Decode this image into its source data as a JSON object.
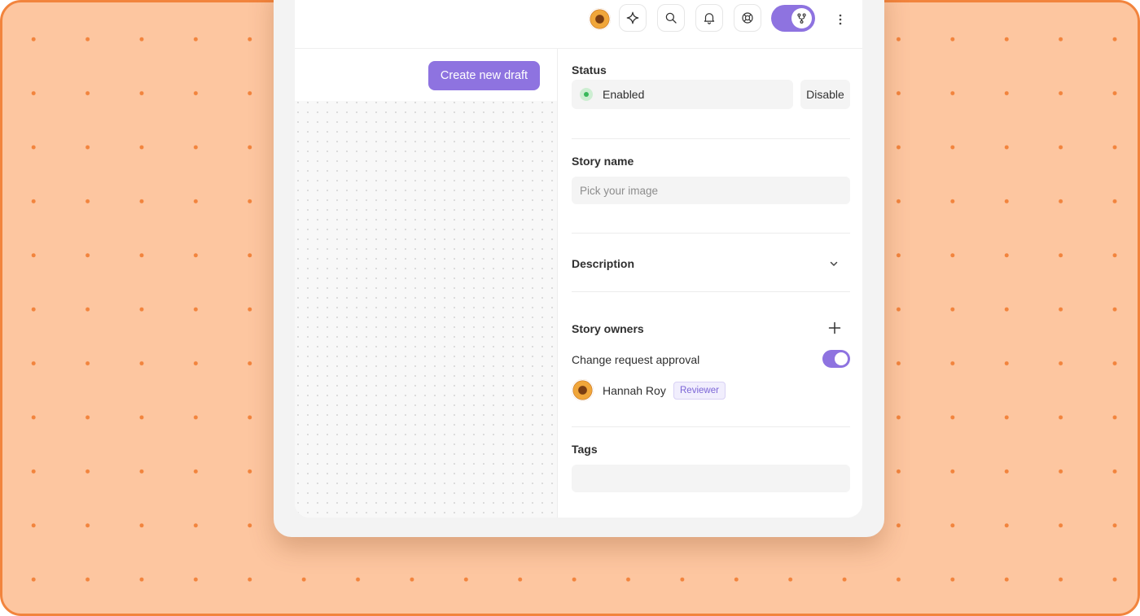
{
  "colors": {
    "accent": "#8e73e0",
    "backdrop": "#fdc6a0",
    "backdrop_dots": "#f2843d",
    "status_enabled": "#38b85a"
  },
  "topbar": {
    "icons": [
      "user-avatar",
      "sparkle-icon",
      "search-icon",
      "bell-icon",
      "help-lifebuoy-icon",
      "branch-icon",
      "more-vertical-icon"
    ],
    "mode_toggle": {
      "on": true
    }
  },
  "draft": {
    "create_label": "Create new draft"
  },
  "panel": {
    "status": {
      "label": "Status",
      "value": "Enabled",
      "disable_label": "Disable"
    },
    "story_name": {
      "label": "Story name",
      "placeholder": "Pick your image",
      "value": ""
    },
    "description": {
      "label": "Description",
      "expanded": false
    },
    "owners": {
      "label": "Story owners",
      "approval_label": "Change request approval",
      "approval_on": true,
      "list": [
        {
          "name": "Hannah Roy",
          "role": "Reviewer"
        }
      ]
    },
    "tags": {
      "label": "Tags",
      "value": ""
    }
  }
}
